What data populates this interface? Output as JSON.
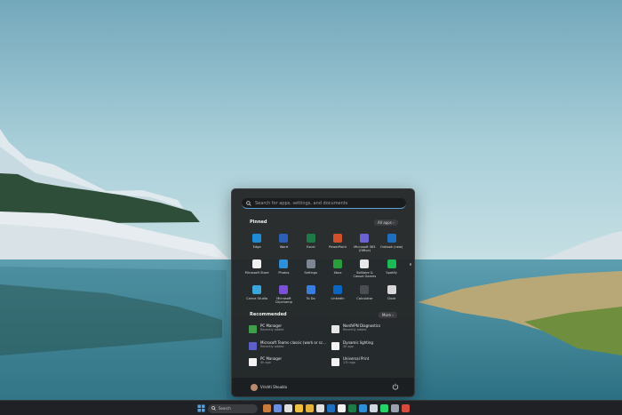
{
  "start_menu": {
    "search_placeholder": "Search for apps, settings, and documents",
    "pinned_title": "Pinned",
    "all_apps_label": "All apps  ›",
    "pinned_apps": [
      {
        "label": "Edge",
        "icon": "edge-icon",
        "color": "#1e8bd6"
      },
      {
        "label": "Word",
        "icon": "word-icon",
        "color": "#2b5fb8"
      },
      {
        "label": "Excel",
        "icon": "excel-icon",
        "color": "#1e7a46"
      },
      {
        "label": "PowerPoint",
        "icon": "powerpoint-icon",
        "color": "#d0502c"
      },
      {
        "label": "Microsoft 365 (Office)",
        "icon": "office-icon",
        "color": "#6b62d6"
      },
      {
        "label": "Outlook (new)",
        "icon": "outlook-icon",
        "color": "#1f6fc0"
      },
      {
        "label": "Microsoft Store",
        "icon": "store-icon",
        "color": "#f0f0f0"
      },
      {
        "label": "Photos",
        "icon": "photos-icon",
        "color": "#2d8fd8"
      },
      {
        "label": "Settings",
        "icon": "settings-gear-icon",
        "color": "#7d8794"
      },
      {
        "label": "Xbox",
        "icon": "xbox-icon",
        "color": "#2a9e3a"
      },
      {
        "label": "Solitaire & Casual Games",
        "icon": "solitaire-icon",
        "color": "#e8e8e8"
      },
      {
        "label": "Spotify",
        "icon": "spotify-icon",
        "color": "#1db954"
      },
      {
        "label": "Canva Studio",
        "icon": "camera-studio-icon",
        "color": "#3aa6d9"
      },
      {
        "label": "Microsoft Clipchamp",
        "icon": "clipchamp-icon",
        "color": "#7b4fd6"
      },
      {
        "label": "To Do",
        "icon": "todo-icon",
        "color": "#3a7de0"
      },
      {
        "label": "LinkedIn",
        "icon": "linkedin-icon",
        "color": "#0a66c2"
      },
      {
        "label": "Calculator",
        "icon": "calculator-icon",
        "color": "#4a4d52"
      },
      {
        "label": "Clock",
        "icon": "clock-icon",
        "color": "#d8d8d8"
      }
    ],
    "recommended_title": "Recommended",
    "more_label": "More  ›",
    "recommended": [
      {
        "title": "PC Manager",
        "sub": "Recently added",
        "icon": "pc-manager-icon",
        "color": "#3f9e4a"
      },
      {
        "title": "NordVPN Diagnostics",
        "sub": "Recently added",
        "icon": "nordvpn-icon",
        "color": "#e6e6e6"
      },
      {
        "title": "Microsoft Teams classic (work or sc...",
        "sub": "Recently added",
        "icon": "teams-icon",
        "color": "#5b5fc7"
      },
      {
        "title": "Dynamic lighting",
        "sub": "3h ago",
        "icon": "document-icon",
        "color": "#f2f2f2"
      },
      {
        "title": "PC Manager",
        "sub": "4h ago",
        "icon": "document-icon",
        "color": "#f2f2f2"
      },
      {
        "title": "Universal Print",
        "sub": "17h ago",
        "icon": "document-icon",
        "color": "#f2f2f2"
      }
    ],
    "user_name": "Vrishti Shoukla"
  },
  "taskbar": {
    "search_label": "Search",
    "icons": [
      {
        "icon": "widgets-icon",
        "color": "#c97b3c"
      },
      {
        "icon": "copilot-icon",
        "color": "#6a8fe0"
      },
      {
        "icon": "task-view-icon",
        "color": "#e0e0e0"
      },
      {
        "icon": "file-explorer-icon",
        "color": "#f0c040"
      },
      {
        "icon": "chrome-icon",
        "color": "#e3b23c"
      },
      {
        "icon": "calendar-icon",
        "color": "#e0e0e0"
      },
      {
        "icon": "outlook-icon",
        "color": "#1f6fc0"
      },
      {
        "icon": "store-icon",
        "color": "#f0f0f0"
      },
      {
        "icon": "excel-icon",
        "color": "#1e7a46"
      },
      {
        "icon": "photos-icon",
        "color": "#2d8fd8"
      },
      {
        "icon": "notepad-icon",
        "color": "#cfd7e0"
      },
      {
        "icon": "whatsapp-icon",
        "color": "#25d366"
      },
      {
        "icon": "settings-gear-icon",
        "color": "#9aa3ad"
      },
      {
        "icon": "chrome-icon",
        "color": "#d64a3c"
      }
    ]
  }
}
